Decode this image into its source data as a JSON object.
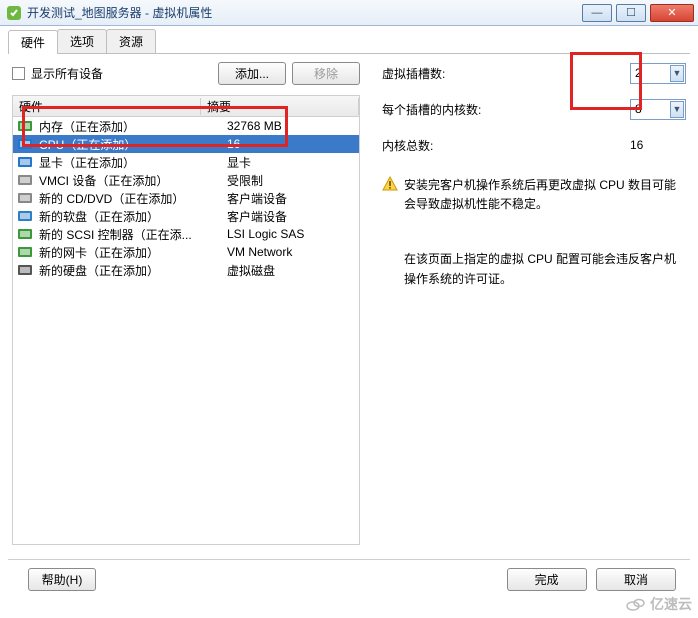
{
  "window": {
    "title": "开发测试_地图服务器 - 虚拟机属性",
    "minimize_icon": "—",
    "maximize_icon": "☐",
    "close_icon": "✕"
  },
  "tabs": {
    "t0": "硬件",
    "t1": "选项",
    "t2": "资源",
    "active": 0
  },
  "toolbar": {
    "show_all_label": "显示所有设备",
    "add_label": "添加...",
    "remove_label": "移除"
  },
  "columns": {
    "hardware": "硬件",
    "summary": "摘要"
  },
  "rows": [
    {
      "name": "内存（正在添加）",
      "summary": "32768 MB",
      "iconColor": "#3a9a3a",
      "sel": false
    },
    {
      "name": "CPU（正在添加）",
      "summary": "16",
      "iconColor": "#2277cc",
      "sel": true
    },
    {
      "name": "显卡（正在添加）",
      "summary": "显卡",
      "iconColor": "#2277cc",
      "sel": false
    },
    {
      "name": "VMCI 设备（正在添加）",
      "summary": "受限制",
      "iconColor": "#888888",
      "sel": false
    },
    {
      "name": "新的 CD/DVD（正在添加）",
      "summary": "客户端设备",
      "iconColor": "#888888",
      "sel": false
    },
    {
      "name": "新的软盘（正在添加）",
      "summary": "客户端设备",
      "iconColor": "#2e7fc4",
      "sel": false
    },
    {
      "name": "新的 SCSI 控制器（正在添...",
      "summary": "LSI Logic SAS",
      "iconColor": "#3a9a3a",
      "sel": false
    },
    {
      "name": "新的网卡（正在添加）",
      "summary": "VM Network",
      "iconColor": "#3a9a3a",
      "sel": false
    },
    {
      "name": "新的硬盘（正在添加）",
      "summary": "虚拟磁盘",
      "iconColor": "#555555",
      "sel": false
    }
  ],
  "right": {
    "sockets_label": "虚拟插槽数:",
    "sockets_value": "2",
    "cores_label": "每个插槽的内核数:",
    "cores_value": "8",
    "total_label": "内核总数:",
    "total_value": "16",
    "warning": "安装完客户机操作系统后再更改虚拟 CPU 数目可能会导致虚拟机性能不稳定。",
    "note": "在该页面上指定的虚拟 CPU 配置可能会违反客户机操作系统的许可证。"
  },
  "footer": {
    "help": "帮助(H)",
    "finish": "完成",
    "cancel": "取消"
  },
  "watermark": "亿速云"
}
